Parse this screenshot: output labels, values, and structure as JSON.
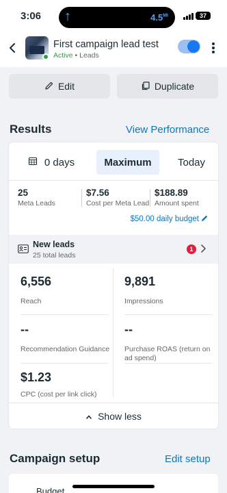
{
  "status_bar": {
    "time": "3:06",
    "speed": "4.5",
    "speed_unit": "MI",
    "battery": "37"
  },
  "header": {
    "title": "First campaign lead test",
    "status": "Active",
    "separator": " • ",
    "objective": "Leads",
    "toggle_on": true
  },
  "actions": {
    "edit_label": "Edit",
    "duplicate_label": "Duplicate"
  },
  "results": {
    "title": "Results",
    "view_performance": "View Performance",
    "ranges": {
      "days": "0 days",
      "maximum": "Maximum",
      "today": "Today",
      "selected": "maximum"
    },
    "summary": [
      {
        "value": "25",
        "label": "Meta Leads"
      },
      {
        "value": "$7.56",
        "label": "Cost per Meta Lead"
      },
      {
        "value": "$188.89",
        "label": "Amount spent"
      }
    ],
    "daily_budget": "$50.00 daily budget",
    "leads": {
      "title": "New leads",
      "subtitle": "25 total leads",
      "badge": "1"
    },
    "metrics": [
      {
        "value": "6,556",
        "label": "Reach"
      },
      {
        "value": "9,891",
        "label": "Impressions"
      },
      {
        "value": "--",
        "label": "Recommendation Guidance"
      },
      {
        "value": "--",
        "label": "Purchase ROAS (return on ad spend)"
      },
      {
        "value": "$1.23",
        "label": "CPC (cost per link click)"
      }
    ],
    "show_less": "Show less"
  },
  "campaign_setup": {
    "title": "Campaign setup",
    "edit_setup": "Edit setup",
    "budget_label": "Budget"
  },
  "colors": {
    "accent": "#0a78be",
    "active_green": "#2ea043",
    "toggle_blue": "#1877f2",
    "badge_red": "#e41e3f"
  }
}
